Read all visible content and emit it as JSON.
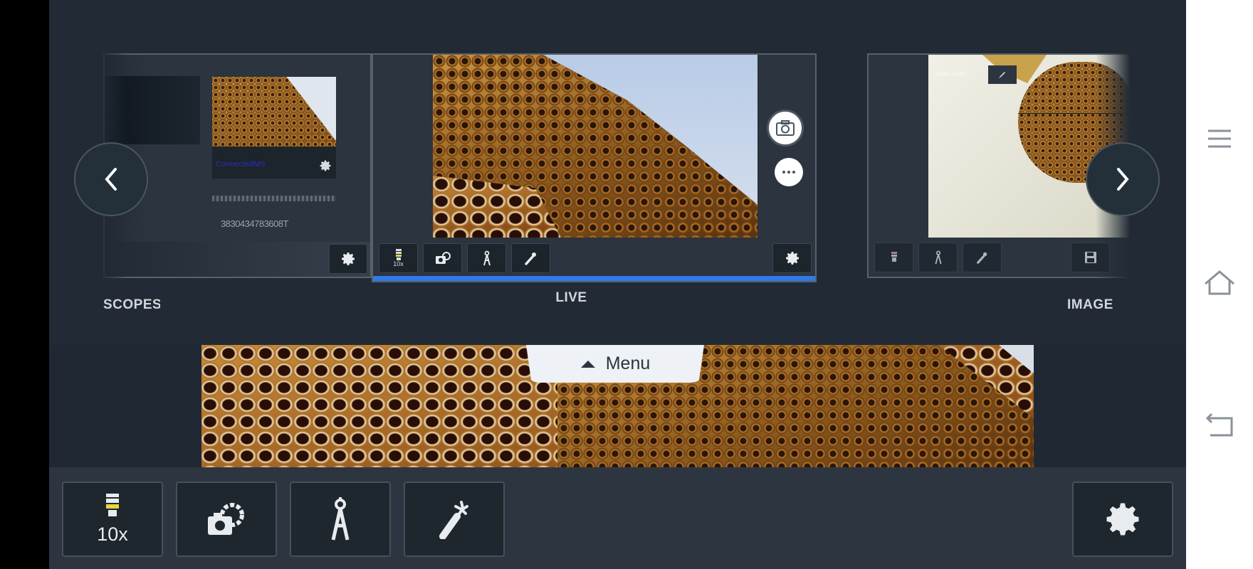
{
  "carousel": {
    "left_card": {
      "label": "SCOPES",
      "link_text": "ConnectedMS",
      "serial": "3830434783608T"
    },
    "center_card": {
      "label": "LIVE",
      "objective": "10x"
    },
    "right_card": {
      "label": "IMAGE",
      "overlay_text": "Scan 3340"
    }
  },
  "menu": {
    "label": "Menu"
  },
  "toolbar": {
    "objective": "10x"
  },
  "colors": {
    "accent": "#2f7ae5",
    "panel": "#222b35",
    "toolbar": "#2d3640"
  },
  "icons": [
    "chevron-left-icon",
    "chevron-right-icon",
    "camera-icon",
    "more-icon",
    "objective-icon",
    "camera-settings-icon",
    "compass-icon",
    "pipette-icon",
    "gear-icon",
    "save-icon",
    "hamburger-icon",
    "home-icon",
    "back-icon"
  ]
}
